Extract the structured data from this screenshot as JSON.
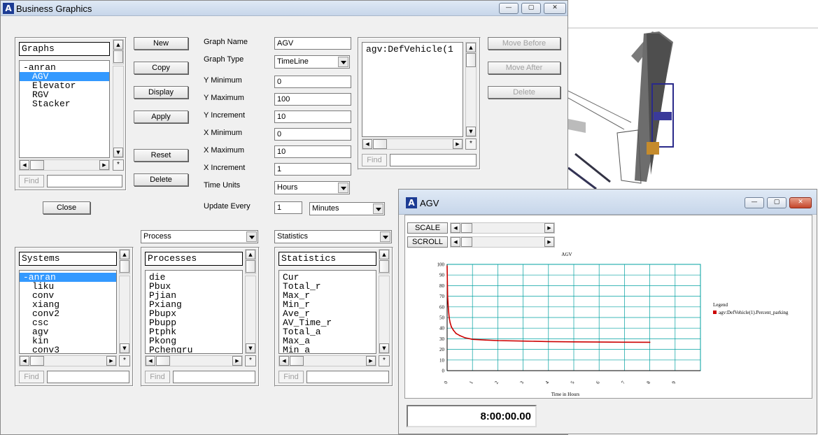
{
  "main_window": {
    "title": "Business Graphics",
    "title_buttons": [
      "minimize-button",
      "maximize-button",
      "close-button"
    ]
  },
  "graphs_panel": {
    "header": "Graphs",
    "items": [
      "-anran",
      "AGV",
      "Elevator",
      "RGV",
      "Stacker"
    ],
    "selected_index": 1,
    "find_label": "Find"
  },
  "buttons": {
    "new": "New",
    "copy": "Copy",
    "display": "Display",
    "apply": "Apply",
    "reset": "Reset",
    "delete": "Delete",
    "close": "Close"
  },
  "form": {
    "graph_name_label": "Graph Name",
    "graph_name_value": "AGV",
    "graph_type_label": "Graph Type",
    "graph_type_value": "TimeLine",
    "y_minimum_label": "Y Minimum",
    "y_minimum_value": "0",
    "y_maximum_label": "Y Maximum",
    "y_maximum_value": "100",
    "y_increment_label": "Y Increment",
    "y_increment_value": "10",
    "x_minimum_label": "X Minimum",
    "x_minimum_value": "0",
    "x_maximum_label": "X Maximum",
    "x_maximum_value": "10",
    "x_increment_label": "X Increment",
    "x_increment_value": "1",
    "time_units_label": "Time Units",
    "time_units_value": "Hours",
    "update_every_label": "Update Every",
    "update_every_value": "1",
    "update_every_unit": "Minutes"
  },
  "vars_panel": {
    "items": [
      "agv:DefVehicle(1"
    ],
    "find_label": "Find",
    "move_before": "Move Before",
    "move_after": "Move After",
    "delete": "Delete"
  },
  "systems_panel": {
    "header": "Systems",
    "items": [
      "-anran",
      "liku",
      "conv",
      "xiang",
      "conv2",
      "csc",
      "agv",
      "kin",
      "conv3"
    ],
    "selected_index": 0,
    "find_label": "Find"
  },
  "processes_panel": {
    "combo_value": "Process",
    "header": "Processes",
    "items": [
      "die",
      "Pbux",
      "Pjian",
      "Pxiang",
      "Pbupx",
      "Pbupp",
      "Ptphk",
      "Pkong",
      "Pchengru"
    ],
    "find_label": "Find"
  },
  "statistics_panel": {
    "combo_value": "Statistics",
    "header": "Statistics",
    "items": [
      "Cur",
      "Total_r",
      "Max_r",
      "Min_r",
      "Ave_r",
      "AV_Time_r",
      "Total_a",
      "Max_a",
      "Min_a"
    ],
    "find_label": "Find"
  },
  "graph_window": {
    "title": "AGV",
    "scale_label": "SCALE",
    "scroll_label": "SCROLL",
    "clock": "8:00:00.00"
  },
  "chart_data": {
    "type": "line",
    "title": "AGV",
    "xlabel": "Time in Hours",
    "ylabel": "",
    "xlim": [
      0,
      10
    ],
    "ylim": [
      0,
      100
    ],
    "x_ticks": [
      "0",
      "1",
      "2",
      "3",
      "4",
      "5",
      "6",
      "7",
      "8",
      "9"
    ],
    "y_ticks": [
      "0",
      "10",
      "20",
      "30",
      "40",
      "50",
      "60",
      "70",
      "80",
      "90",
      "100"
    ],
    "grid": true,
    "legend_title": "Legend",
    "legend_placement": "right",
    "series": [
      {
        "name": "agv:DefVehicle(1).Percent_parking",
        "color": "#cc0000",
        "x": [
          0,
          0.02,
          0.05,
          0.08,
          0.12,
          0.17,
          0.25,
          0.35,
          0.5,
          0.7,
          1.0,
          1.5,
          2.0,
          3.0,
          4.0,
          5.0,
          6.0,
          7.0,
          8.0
        ],
        "y": [
          98,
          70,
          58,
          50,
          45,
          41,
          38,
          35,
          33,
          31,
          29.5,
          28.8,
          28.3,
          27.8,
          27.4,
          27.1,
          26.9,
          26.8,
          26.7
        ]
      }
    ]
  },
  "colors": {
    "selection": "#3399ff",
    "chart_grid": "#00a0a0",
    "series": "#cc0000"
  }
}
